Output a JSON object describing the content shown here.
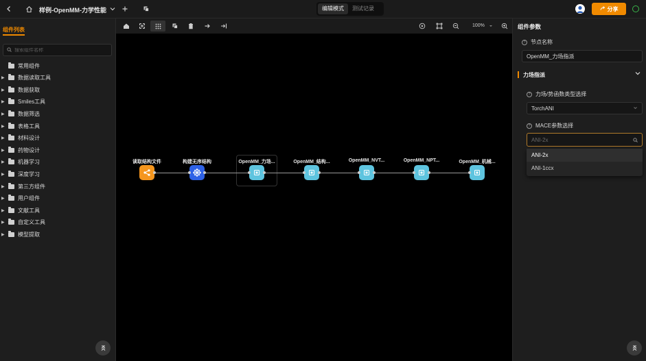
{
  "topbar": {
    "title": "样例-OpenMM-力学性能",
    "modes": [
      {
        "label": "编辑模式",
        "active": true
      },
      {
        "label": "测试记录",
        "active": false
      }
    ],
    "share_label": "分享",
    "accent_color": "#f08a00"
  },
  "sidebar": {
    "title": "组件列表",
    "search_placeholder": "搜索组件名称",
    "items": [
      {
        "label": "常用组件",
        "has_children": false
      },
      {
        "label": "数据读取工具",
        "has_children": true
      },
      {
        "label": "数据获取",
        "has_children": true
      },
      {
        "label": "Smiles工具",
        "has_children": true
      },
      {
        "label": "数据筛选",
        "has_children": true
      },
      {
        "label": "表格工具",
        "has_children": true
      },
      {
        "label": "材料设计",
        "has_children": true
      },
      {
        "label": "药物设计",
        "has_children": true
      },
      {
        "label": "机器学习",
        "has_children": true
      },
      {
        "label": "深度学习",
        "has_children": true
      },
      {
        "label": "第三方组件",
        "has_children": true
      },
      {
        "label": "用户组件",
        "has_children": true
      },
      {
        "label": "文献工具",
        "has_children": true
      },
      {
        "label": "自定义工具",
        "has_children": true
      },
      {
        "label": "模型提取",
        "has_children": true
      }
    ]
  },
  "canvas": {
    "zoom": "100%",
    "nodes": [
      {
        "label": "读取结构文件",
        "color": "#f5961e",
        "icon": "share-icon"
      },
      {
        "label": "构建无序结构",
        "color": "#2f62e6",
        "icon": "network-icon"
      },
      {
        "label": "OpenMM_力场...",
        "color": "#5ec4df",
        "icon": "chip-icon"
      },
      {
        "label": "OpenMM_结构...",
        "color": "#5ec4df",
        "icon": "chip-icon"
      },
      {
        "label": "OpenMM_NVT...",
        "color": "#5ec4df",
        "icon": "chip-icon"
      },
      {
        "label": "OpenMM_NPT...",
        "color": "#5ec4df",
        "icon": "chip-icon"
      },
      {
        "label": "OpenMM_机械...",
        "color": "#5ec4df",
        "icon": "chip-icon"
      }
    ]
  },
  "panel": {
    "title": "组件参数",
    "node_name_label": "节点名称",
    "node_name_value": "OpenMM_力场指派",
    "section_label": "力场指派",
    "ff_type_label": "力场/势函数类型选择",
    "ff_type_value": "TorchANI",
    "mace_label": "MACE参数选择",
    "mace_placeholder": "ANI-2x",
    "options": [
      "ANI-2x",
      "ANI-1ccx"
    ]
  }
}
